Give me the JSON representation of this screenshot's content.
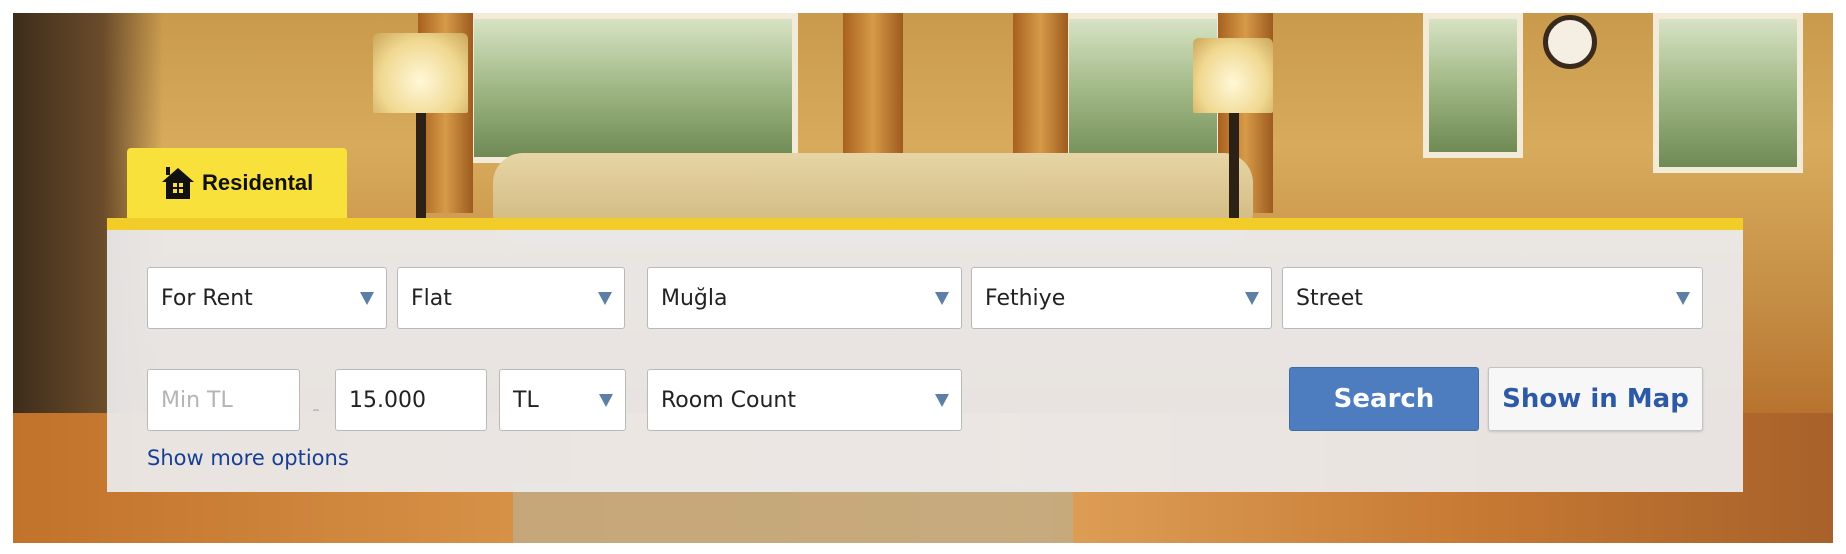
{
  "tab": {
    "label": "Residental",
    "icon": "home-icon"
  },
  "filters": {
    "listing_type": "For Rent",
    "property_type": "Flat",
    "province": "Muğla",
    "district": "Fethiye",
    "neighbourhood": "Street",
    "min_price_placeholder": "Min TL",
    "price_separator": "-",
    "max_price_value": "15.000",
    "currency": "TL",
    "room_count": "Room Count"
  },
  "actions": {
    "search_label": "Search",
    "map_label": "Show in Map",
    "more_options_label": "Show more options"
  },
  "colors": {
    "tab_yellow": "#f7e13a",
    "panel_border": "#f2cd2a",
    "search_button": "#4d7dbf",
    "link_blue": "#173f93",
    "select_arrow": "#5d7ea5"
  }
}
